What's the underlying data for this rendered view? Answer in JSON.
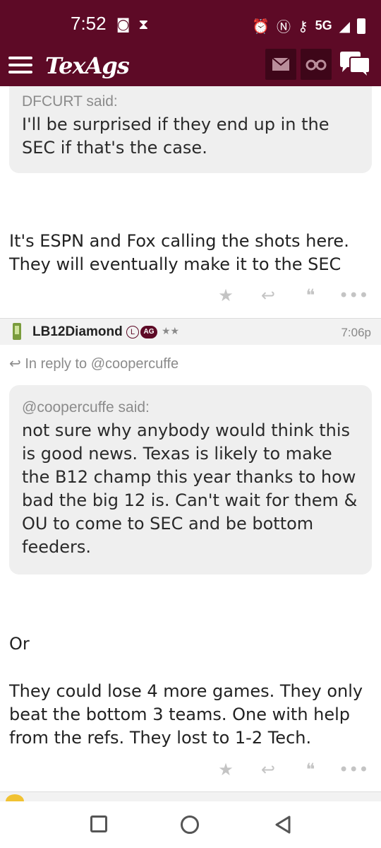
{
  "status_bar": {
    "time": "7:52",
    "network": "5G"
  },
  "header": {
    "logo": "TexAgs",
    "icons": [
      "menu-icon",
      "mail-icon",
      "binoculars-icon",
      "chat-icon"
    ]
  },
  "quote1": {
    "author": "DFCURT said:",
    "text": "I'll be surprised if they end up in the SEC if that's the case."
  },
  "post1": {
    "body": "It's ESPN and Fox calling the shots here. They will eventually make it to the SEC"
  },
  "post2": {
    "username": "LB12Diamond",
    "badge_l": "L",
    "badge_ag": "AG",
    "stars": "★★",
    "time": "7:06p",
    "reply_to": "In reply to @coopercuffe",
    "quote_author": "@coopercuffe said:",
    "quote_text": "not sure why anybody would think this is good news. Texas is likely to make the B12 champ this year thanks to how bad the big 12 is. Can't wait for them & OU to come to SEC and be bottom feeders.",
    "body_line1": "Or",
    "body_line2": "They could lose 4 more games. They only beat the bottom 3 teams. One with help from the refs. They lost to 1-2 Tech."
  },
  "actions": {
    "star": "★",
    "reply": "↩",
    "quote": "❝",
    "more": "•••"
  },
  "colors": {
    "maroon": "#5d0a26",
    "quote_bg": "#efefef"
  }
}
